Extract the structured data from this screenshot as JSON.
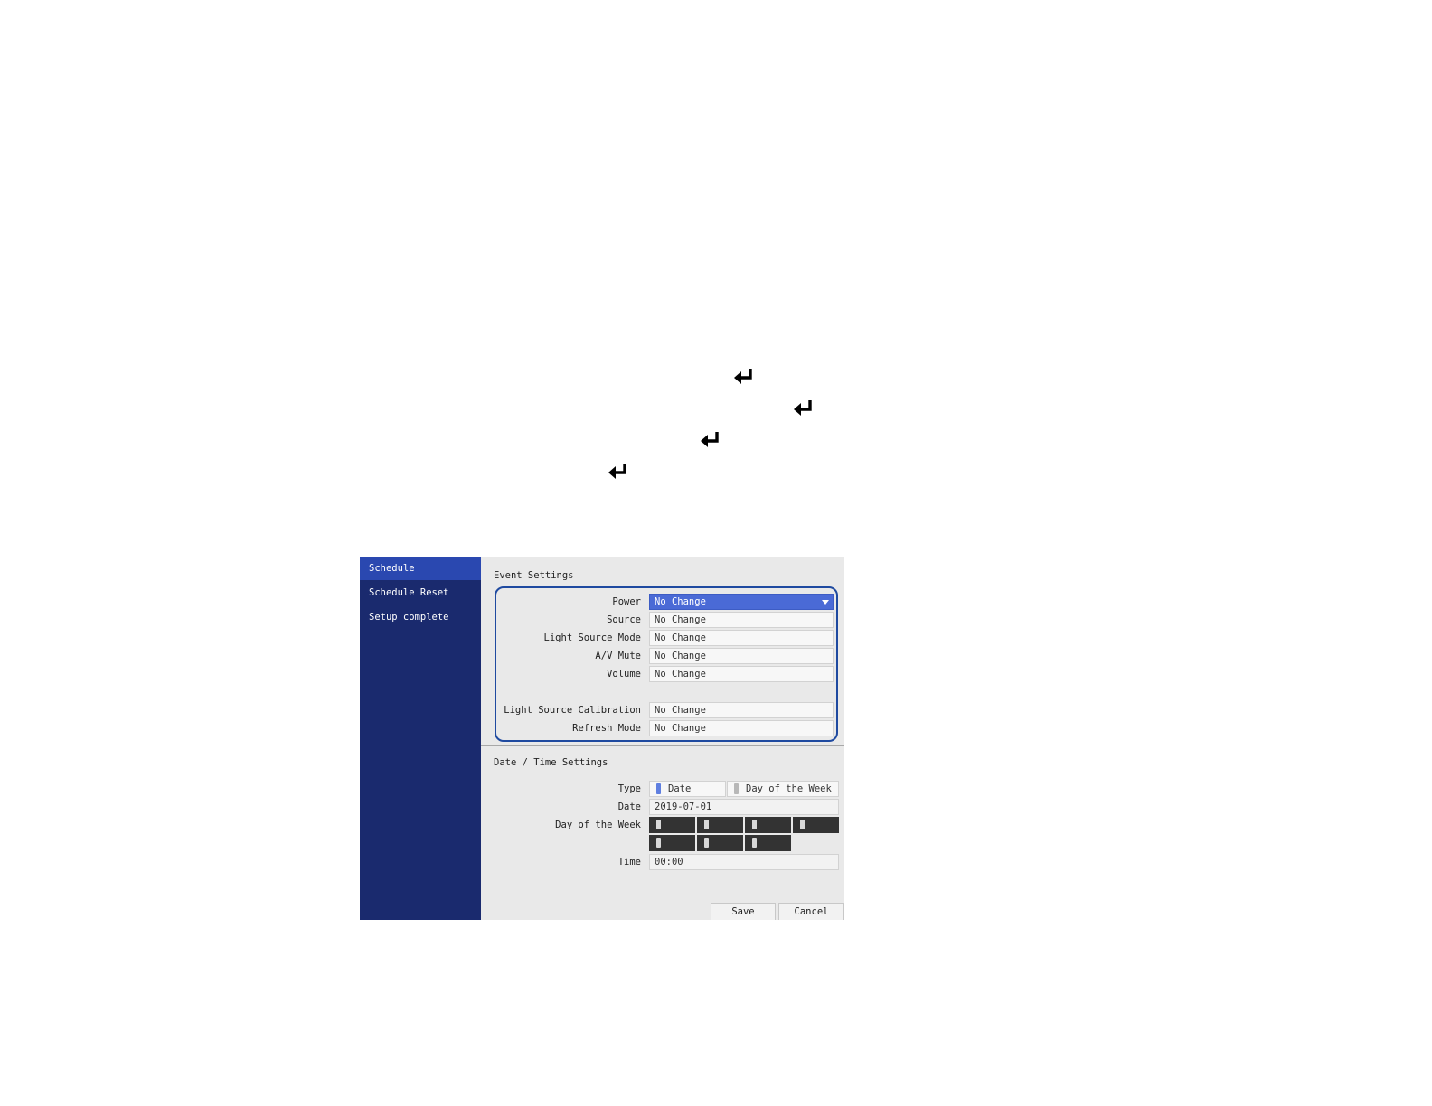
{
  "sidebar": {
    "items": [
      {
        "label": "Schedule"
      },
      {
        "label": "Schedule Reset"
      },
      {
        "label": "Setup complete"
      }
    ]
  },
  "event_settings": {
    "title": "Event Settings",
    "rows": [
      {
        "label": "Power",
        "value": "No Change"
      },
      {
        "label": "Source",
        "value": "No Change"
      },
      {
        "label": "Light Source Mode",
        "value": "No Change"
      },
      {
        "label": "A/V Mute",
        "value": "No Change"
      },
      {
        "label": "Volume",
        "value": "No Change"
      },
      {
        "label": "Light Source Calibration",
        "value": "No Change"
      },
      {
        "label": "Refresh Mode",
        "value": "No Change"
      }
    ]
  },
  "datetime_settings": {
    "title": "Date / Time Settings",
    "type_label": "Type",
    "type_options": [
      "Date",
      "Day of the Week"
    ],
    "selected_type": "Date",
    "date_label": "Date",
    "date_value": "2019-07-01",
    "dow_label": "Day of the Week",
    "time_label": "Time",
    "time_value": "00:00"
  },
  "buttons": {
    "save": "Save",
    "cancel": "Cancel"
  },
  "icons": {
    "enter": "enter-return-icon",
    "dropdown": "dropdown-arrow-icon"
  },
  "colors": {
    "sidebar_bg": "#1a2a6e",
    "sidebar_active": "#2a48b0",
    "selected_field": "#4a6ad6",
    "highlight_border": "#1f4aa0"
  }
}
